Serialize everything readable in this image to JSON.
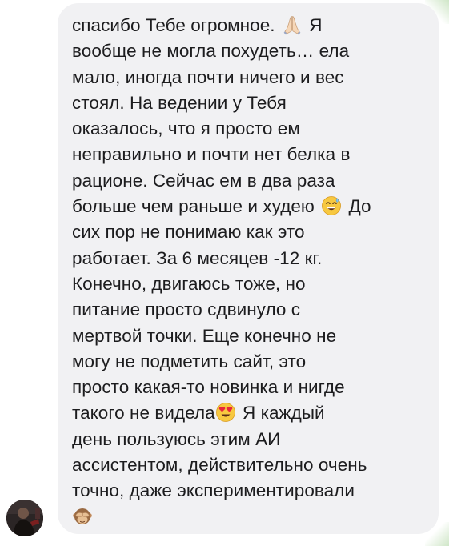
{
  "message": {
    "lines": [
      {
        "text": "спасибо Тебе огромное. ",
        "emoji": "folded-hands-emoji",
        "after": " Я"
      },
      {
        "text": "вообще не могла похудеть… ела"
      },
      {
        "text": "мало, иногда почти ничего и вес"
      },
      {
        "text": "стоял. На ведении у Тебя"
      },
      {
        "text": "оказалось, что я просто ем"
      },
      {
        "text": "неправильно и почти нет белка в"
      },
      {
        "text": "рационе. Сейчас ем в два раза"
      },
      {
        "text": "больше чем раньше и худею ",
        "emoji": "grinning-face-with-sweat-emoji",
        "after": " До"
      },
      {
        "text": "сих пор не понимаю как это"
      },
      {
        "text": "работает. За 6 месяцев -12 кг."
      },
      {
        "text": "Конечно, двигаюсь тоже, но"
      },
      {
        "text": "питание просто сдвинуло с"
      },
      {
        "text": "мертвой точки. Еще конечно не"
      },
      {
        "text": "могу не подметить сайт, это"
      },
      {
        "text": "просто какая-то новинка и нигде"
      },
      {
        "text": "такого не видела",
        "emoji": "smiling-face-with-heart-eyes-emoji",
        "after": " Я каждый"
      },
      {
        "text": "день пользуюсь этим АИ"
      },
      {
        "text": "ассистентом, действительно очень"
      },
      {
        "text": "точно, даже экспериментировали"
      },
      {
        "text": "",
        "emoji": "see-no-evil-monkey-emoji",
        "after": ""
      }
    ]
  },
  "colors": {
    "bubble": "#f1f1f3",
    "text": "#1c1c1e",
    "background": "#ffffff"
  },
  "sender": {
    "avatar_icon": "profile-photo"
  }
}
